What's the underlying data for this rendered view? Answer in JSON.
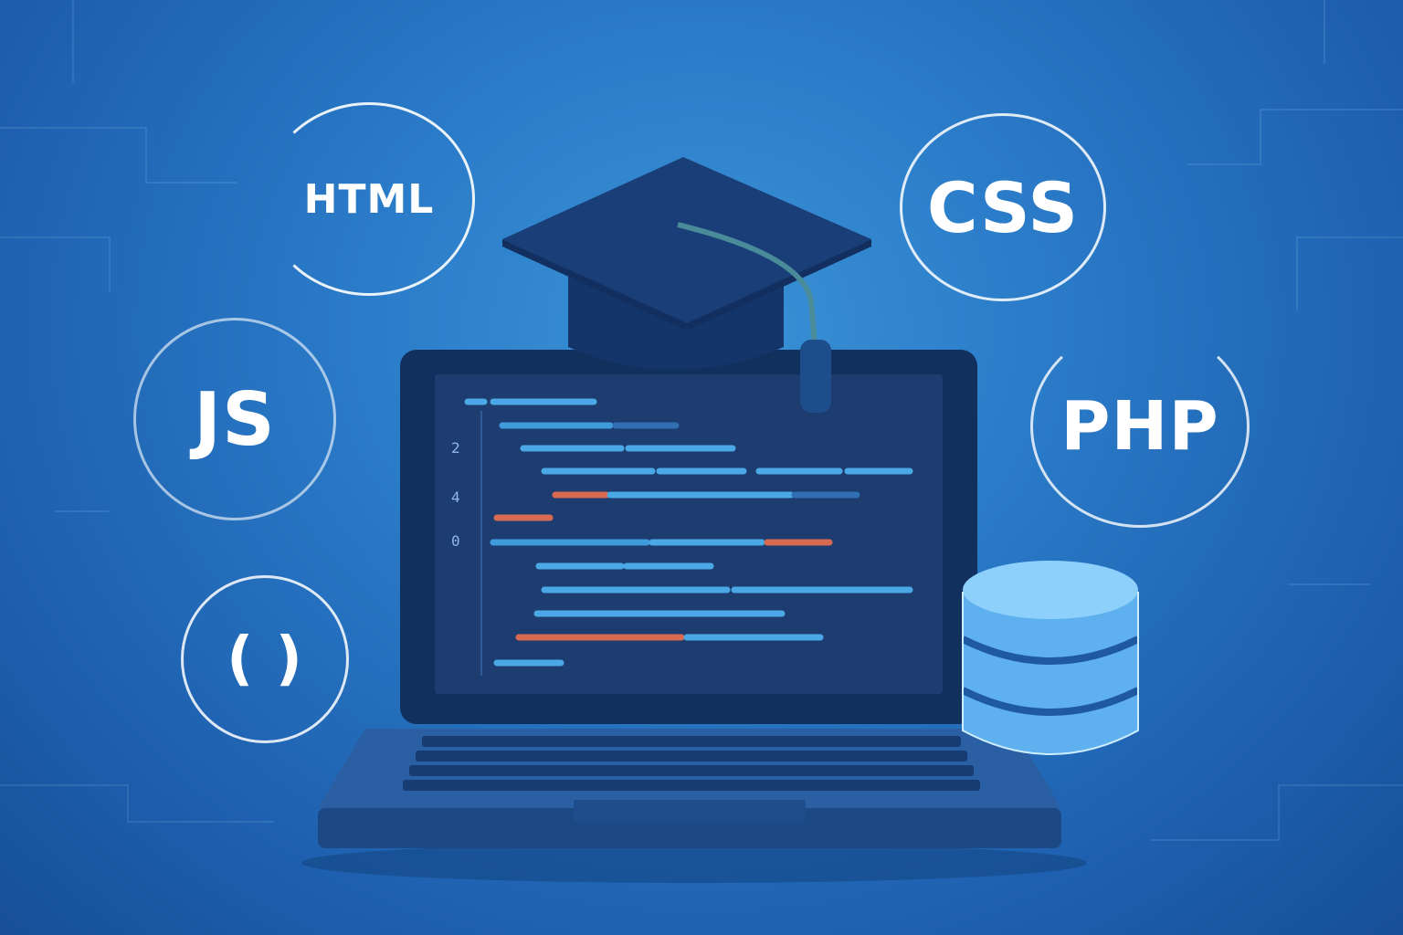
{
  "badges": {
    "html": "HTML",
    "css": "CSS",
    "js": "JS",
    "php": "PHP",
    "braces": "( )"
  },
  "code_editor": {
    "line_numbers": [
      "2",
      "4",
      "0"
    ]
  },
  "icons": [
    "graduation-cap-icon",
    "laptop-icon",
    "database-icon"
  ],
  "colors": {
    "background": "#2a7bc8",
    "screen": "#1b3a6b",
    "code_blue": "#4aa8e6",
    "code_orange": "#d86a52",
    "cap": "#16386d",
    "database": "#7cc4f4"
  }
}
